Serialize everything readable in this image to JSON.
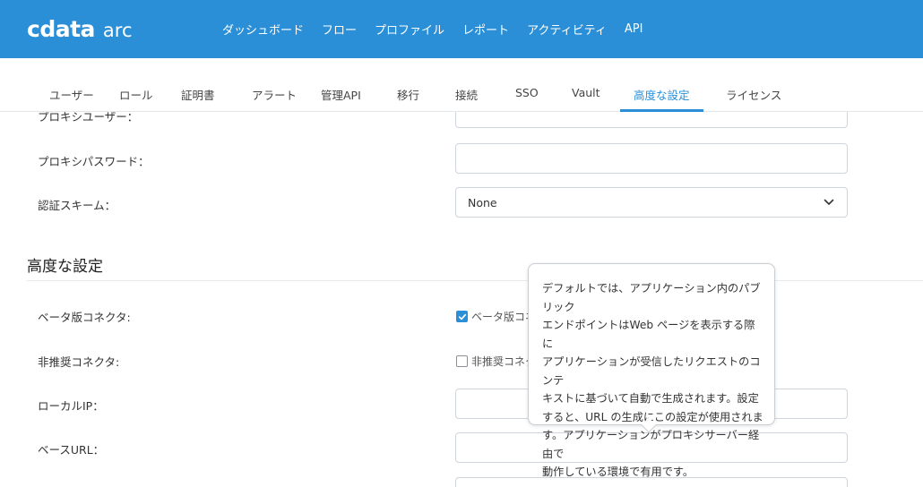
{
  "app": {
    "brand": "cdata",
    "product": "arc"
  },
  "nav": {
    "items": [
      "ダッシュボード",
      "フロー",
      "プロファイル",
      "レポート",
      "アクティビティ",
      "API"
    ]
  },
  "tabs": {
    "items": [
      "ユーザー",
      "ロール",
      "証明書",
      "アラート",
      "管理API",
      "移行",
      "接続",
      "SSO",
      "Vault",
      "高度な設定",
      "ライセンス"
    ],
    "active": "高度な設定"
  },
  "proxy": {
    "user_label": "プロキシユーザー：",
    "password_label": "プロキシパスワード：",
    "password_value": "",
    "auth_label": "認証スキーム：",
    "auth_value": "None"
  },
  "advanced": {
    "title": "高度な設定",
    "beta_label": "ベータ版コネクタ:",
    "beta_checkbox_label": "ベータ版コネクタ",
    "beta_checked": true,
    "deprecated_label": "非推奨コネクタ:",
    "deprecated_checkbox_label": "非推奨コネクタ",
    "deprecated_checked": false,
    "local_ip_label": "ローカルIP：",
    "local_ip_value": "",
    "base_url_label": "ベースURL：",
    "base_url_value": ""
  },
  "tooltip": {
    "text": "デフォルトでは、アプリケーション内のパブリック\nエンドポイントはWeb ページを表示する際に\nアプリケーションが受信したリクエストのコンテ\nキストに基づいて自動で生成されます。設定\nすると、URL の生成にこの設定が使用されま\nす。アプリケーションがプロキシサーバー経由で\n動作している環境で有用です。"
  },
  "colors": {
    "header": "#2a8fd6",
    "accent": "#2a8fd6"
  }
}
